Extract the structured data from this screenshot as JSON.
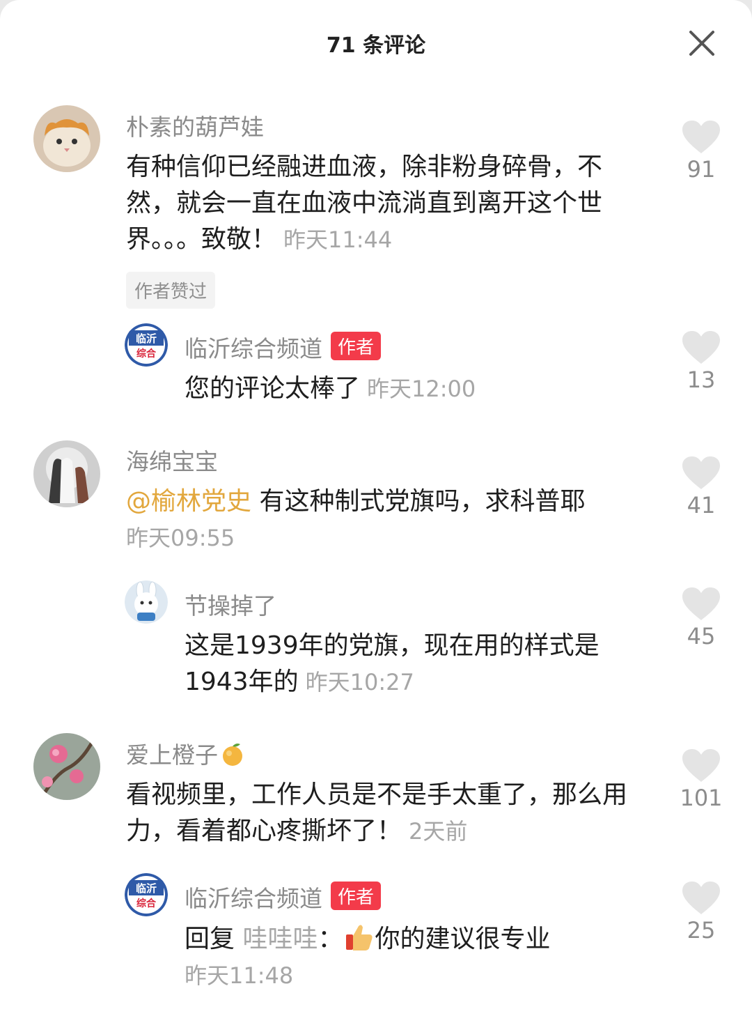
{
  "header": {
    "title": "71 条评论"
  },
  "comments": [
    {
      "username": "朴素的葫芦娃",
      "text": "有种信仰已经融进血液，除非粉身碎骨，不然，就会一直在血液中流淌直到离开这个世界。。。致敬！",
      "time": "昨天11:44",
      "tag": "作者赞过",
      "likes": "91"
    },
    {
      "username": "临沂综合频道",
      "author_badge": "作者",
      "text": "您的评论太棒了",
      "time": "昨天12:00",
      "likes": "13",
      "avatar_text_top": "临沂",
      "avatar_text_bottom": "综合"
    },
    {
      "username": "海绵宝宝",
      "mention": "@榆林党史",
      "text": " 有这种制式党旗吗，求科普耶",
      "time": "昨天09:55",
      "likes": "41"
    },
    {
      "username": "节操掉了",
      "text": "这是1939年的党旗，现在用的样式是1943年的",
      "time": "昨天10:27",
      "likes": "45"
    },
    {
      "username": "爱上橙子",
      "text": "看视频里，工作人员是不是手太重了，那么用力，看着都心疼撕坏了！",
      "time": "2天前",
      "likes": "101"
    },
    {
      "username": "临沂综合频道",
      "author_badge": "作者",
      "reply_prefix": "回复",
      "reply_target": "哇哇哇",
      "reply_colon": "：",
      "text": "你的建议很专业",
      "time": "昨天11:48",
      "likes": "25",
      "avatar_text_top": "临沂",
      "avatar_text_bottom": "综合"
    }
  ],
  "icons": {
    "close": "close-icon",
    "like": "heart-icon",
    "orange_emoji": "orange-emoji-icon",
    "thumbs_up_emoji": "thumbs-up-emoji-icon"
  },
  "colors": {
    "mention": "#e2a73d",
    "author_badge": "#f33b4a",
    "timestamp": "#a6a6a6"
  }
}
